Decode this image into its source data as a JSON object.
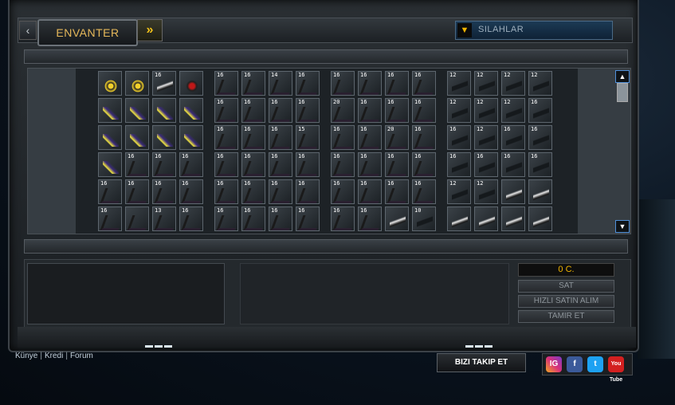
{
  "header": {
    "nav_left": "‹",
    "tab_label": "ENVANTER",
    "nav_right": "»",
    "filter": {
      "arrow": "▼",
      "selected": "SILAHLAR"
    }
  },
  "grid": {
    "groups": [
      {
        "rows": [
          [
            {
              "n": "",
              "i": "gold"
            },
            {
              "n": "",
              "i": "gold"
            },
            {
              "n": "16",
              "i": "white"
            },
            {
              "n": "",
              "i": "red"
            }
          ],
          [
            {
              "n": "",
              "i": "purple"
            },
            {
              "n": "",
              "i": "purple"
            },
            {
              "n": "",
              "i": "purple"
            },
            {
              "n": "",
              "i": "purple"
            }
          ],
          [
            {
              "n": "",
              "i": "purple"
            },
            {
              "n": "",
              "i": "purple"
            },
            {
              "n": "",
              "i": "purple"
            },
            {
              "n": "",
              "i": "purple"
            }
          ],
          [
            {
              "n": "",
              "i": "purple"
            },
            {
              "n": "16",
              "i": "crossbow"
            },
            {
              "n": "16",
              "i": "crossbow"
            },
            {
              "n": "16",
              "i": "crossbow"
            }
          ],
          [
            {
              "n": "16",
              "i": "crossbow"
            },
            {
              "n": "16",
              "i": "crossbow"
            },
            {
              "n": "16",
              "i": "crossbow"
            },
            {
              "n": "16",
              "i": "crossbow"
            }
          ],
          [
            {
              "n": "16",
              "i": "crossbow"
            },
            {
              "n": "",
              "i": "crossbow"
            },
            {
              "n": "13",
              "i": "crossbow"
            },
            {
              "n": "16",
              "i": "crossbow"
            }
          ]
        ]
      },
      {
        "rows": [
          [
            {
              "n": "16",
              "i": "crossbow"
            },
            {
              "n": "16",
              "i": "crossbow"
            },
            {
              "n": "14",
              "i": "crossbow"
            },
            {
              "n": "16",
              "i": "crossbow"
            }
          ],
          [
            {
              "n": "16",
              "i": "crossbow"
            },
            {
              "n": "16",
              "i": "crossbow"
            },
            {
              "n": "16",
              "i": "crossbow"
            },
            {
              "n": "16",
              "i": "crossbow"
            }
          ],
          [
            {
              "n": "16",
              "i": "crossbow"
            },
            {
              "n": "16",
              "i": "crossbow"
            },
            {
              "n": "16",
              "i": "crossbow"
            },
            {
              "n": "15",
              "i": "crossbow"
            }
          ],
          [
            {
              "n": "16",
              "i": "crossbow"
            },
            {
              "n": "16",
              "i": "crossbow"
            },
            {
              "n": "16",
              "i": "crossbow"
            },
            {
              "n": "16",
              "i": "crossbow"
            }
          ],
          [
            {
              "n": "16",
              "i": "crossbow"
            },
            {
              "n": "16",
              "i": "crossbow"
            },
            {
              "n": "16",
              "i": "crossbow"
            },
            {
              "n": "16",
              "i": "crossbow"
            }
          ],
          [
            {
              "n": "16",
              "i": "crossbow"
            },
            {
              "n": "16",
              "i": "crossbow"
            },
            {
              "n": "16",
              "i": "crossbow"
            },
            {
              "n": "16",
              "i": "crossbow"
            }
          ]
        ]
      },
      {
        "rows": [
          [
            {
              "n": "16",
              "i": "crossbow"
            },
            {
              "n": "16",
              "i": "crossbow"
            },
            {
              "n": "16",
              "i": "crossbow"
            },
            {
              "n": "16",
              "i": "crossbow"
            }
          ],
          [
            {
              "n": "20",
              "i": "crossbow"
            },
            {
              "n": "16",
              "i": "crossbow"
            },
            {
              "n": "16",
              "i": "crossbow"
            },
            {
              "n": "16",
              "i": "crossbow"
            }
          ],
          [
            {
              "n": "16",
              "i": "crossbow"
            },
            {
              "n": "16",
              "i": "crossbow"
            },
            {
              "n": "20",
              "i": "crossbow"
            },
            {
              "n": "16",
              "i": "crossbow"
            }
          ],
          [
            {
              "n": "16",
              "i": "crossbow"
            },
            {
              "n": "16",
              "i": "crossbow"
            },
            {
              "n": "16",
              "i": "crossbow"
            },
            {
              "n": "16",
              "i": "crossbow"
            }
          ],
          [
            {
              "n": "16",
              "i": "crossbow"
            },
            {
              "n": "16",
              "i": "crossbow"
            },
            {
              "n": "16",
              "i": "crossbow"
            },
            {
              "n": "16",
              "i": "crossbow"
            }
          ],
          [
            {
              "n": "16",
              "i": "crossbow"
            },
            {
              "n": "16",
              "i": "crossbow"
            },
            {
              "n": "",
              "i": "white"
            },
            {
              "n": "10",
              "i": "gun"
            }
          ]
        ]
      },
      {
        "rows": [
          [
            {
              "n": "12",
              "i": "gun"
            },
            {
              "n": "12",
              "i": "gun"
            },
            {
              "n": "12",
              "i": "gun"
            },
            {
              "n": "12",
              "i": "gun"
            }
          ],
          [
            {
              "n": "12",
              "i": "gun"
            },
            {
              "n": "12",
              "i": "gun"
            },
            {
              "n": "12",
              "i": "gun"
            },
            {
              "n": "16",
              "i": "gun"
            }
          ],
          [
            {
              "n": "16",
              "i": "gun"
            },
            {
              "n": "12",
              "i": "gun"
            },
            {
              "n": "16",
              "i": "gun"
            },
            {
              "n": "16",
              "i": "gun"
            }
          ],
          [
            {
              "n": "16",
              "i": "gun"
            },
            {
              "n": "16",
              "i": "gun"
            },
            {
              "n": "16",
              "i": "gun"
            },
            {
              "n": "16",
              "i": "gun"
            }
          ],
          [
            {
              "n": "12",
              "i": "gun"
            },
            {
              "n": "12",
              "i": "gun"
            },
            {
              "n": "",
              "i": "white"
            },
            {
              "n": "",
              "i": "white"
            }
          ],
          [
            {
              "n": "",
              "i": "white"
            },
            {
              "n": "",
              "i": "white"
            },
            {
              "n": "",
              "i": "white"
            },
            {
              "n": "",
              "i": "white"
            }
          ]
        ]
      }
    ],
    "scroll_up": "▲",
    "scroll_down": "▼"
  },
  "actions": {
    "money": "0 C.",
    "sell": "SAT",
    "quick_sell": "HIZLI SATIN ALIM",
    "repair": "TAMIR ET"
  },
  "footer": {
    "links": [
      "Künye",
      "Kredi",
      "Forum"
    ],
    "separator": "|",
    "follow": "BIZI TAKIP ET",
    "social": [
      {
        "name": "instagram",
        "glyph": "IG"
      },
      {
        "name": "facebook",
        "glyph": "f"
      },
      {
        "name": "twitter",
        "glyph": "t"
      },
      {
        "name": "youtube",
        "glyph": "You Tube"
      }
    ],
    "dots": "▬▬▬"
  }
}
